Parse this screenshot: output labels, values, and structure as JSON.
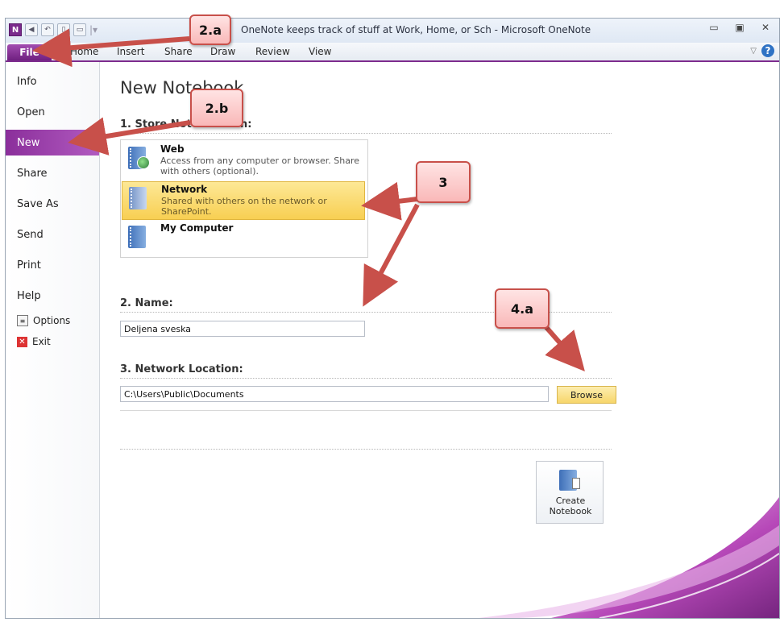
{
  "window": {
    "title": "OneNote keeps track of stuff at Work, Home, or Sch  -  Microsoft OneNote",
    "controls": [
      "minimize-icon",
      "maximize-icon",
      "close-icon"
    ]
  },
  "ribbon": {
    "tabs": [
      "File",
      "Home",
      "Insert",
      "Share",
      "Draw",
      "Review",
      "View"
    ]
  },
  "sidebar": {
    "items": [
      "Info",
      "Open",
      "New",
      "Share",
      "Save As",
      "Send",
      "Print",
      "Help"
    ],
    "active": "New",
    "options_label": "Options",
    "exit_label": "Exit"
  },
  "main": {
    "heading": "New Notebook",
    "store_section": "1. Store Notebook On:",
    "store_options": [
      {
        "title": "Web",
        "desc": "Access from any computer or browser. Share with others (optional)."
      },
      {
        "title": "Network",
        "desc": "Shared with others on the network or SharePoint."
      },
      {
        "title": "My Computer",
        "desc": ""
      }
    ],
    "selected_option": "Network",
    "name_section": "2. Name:",
    "name_value": "Deljena sveska",
    "location_section": "3. Network Location:",
    "location_value": "C:\\Users\\Public\\Documents",
    "browse_label": "Browse",
    "create_label_1": "Create",
    "create_label_2": "Notebook"
  },
  "callouts": [
    "2.a",
    "2.b",
    "3",
    "4.a"
  ],
  "colors": {
    "accent": "#7d2c8e",
    "selected_bg": "#f8cf52",
    "callout_border": "#c8504a",
    "arrow": "#c8504a"
  }
}
